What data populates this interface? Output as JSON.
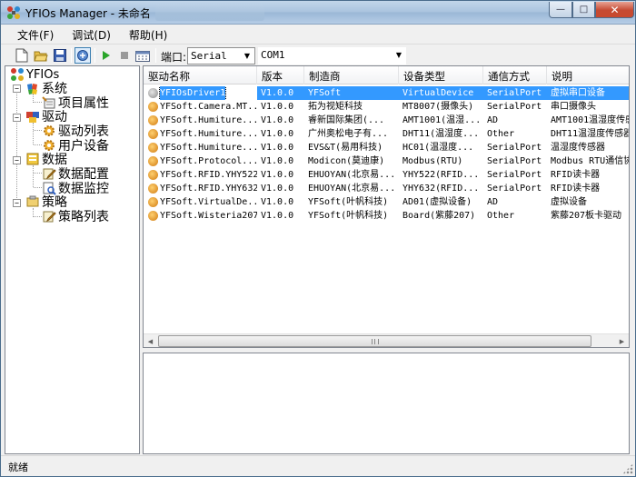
{
  "window": {
    "title": "YFIOs Manager - 未命名",
    "buttons": {
      "minimize": "—",
      "maximize": "□",
      "close": "✕"
    }
  },
  "menu": [
    {
      "label": "文件(F)"
    },
    {
      "label": "调试(D)"
    },
    {
      "label": "帮助(H)"
    }
  ],
  "toolbar": {
    "icons": [
      "new-file-icon",
      "open-folder-icon",
      "save-icon",
      "connect-icon",
      "run-icon",
      "stop-icon",
      "calendar-icon"
    ],
    "port_label": "端口:",
    "port_type": "Serial",
    "port_name": "COM1"
  },
  "tree": {
    "root": "YFIOs",
    "groups": [
      {
        "label": "系统",
        "children": [
          "项目属性"
        ]
      },
      {
        "label": "驱动",
        "children": [
          "驱动列表",
          "用户设备"
        ]
      },
      {
        "label": "数据",
        "children": [
          "数据配置",
          "数据监控"
        ]
      },
      {
        "label": "策略",
        "children": [
          "策略列表"
        ]
      }
    ]
  },
  "table": {
    "columns": [
      "驱动名称",
      "版本",
      "制造商",
      "设备类型",
      "通信方式",
      "说明"
    ],
    "rows": [
      [
        "YFIOsDriver1",
        "V1.0.0",
        "YFSoft",
        "VirtualDevice",
        "SerialPort",
        "虚拟串口设备"
      ],
      [
        "YFSoft.Camera.MT...",
        "V1.0.0",
        "拓为视矩科技",
        "MT8007(摄像头)",
        "SerialPort",
        "串口摄像头"
      ],
      [
        "YFSoft.Humiture....",
        "V1.0.0",
        "睿新国际集团(...",
        "AMT1001(温湿...",
        "AD",
        "AMT1001温湿度传感"
      ],
      [
        "YFSoft.Humiture....",
        "V1.0.0",
        "广州奥松电子有...",
        "DHT11(温湿度...",
        "Other",
        "DHT11温湿度传感器"
      ],
      [
        "YFSoft.Humiture....",
        "V1.0.0",
        "EVS&T(易用科技)",
        "HC01(温湿度...",
        "SerialPort",
        "温湿度传感器"
      ],
      [
        "YFSoft.Protocol....",
        "V1.0.0",
        "Modicon(莫迪康)",
        "Modbus(RTU)",
        "SerialPort",
        "Modbus RTU通信协"
      ],
      [
        "YFSoft.RFID.YHY522",
        "V1.0.0",
        "EHUOYAN(北京易...",
        "YHY522(RFID...",
        "SerialPort",
        "RFID读卡器"
      ],
      [
        "YFSoft.RFID.YHY632",
        "V1.0.0",
        "EHUOYAN(北京易...",
        "YHY632(RFID...",
        "SerialPort",
        "RFID读卡器"
      ],
      [
        "YFSoft.VirtualDe...",
        "V1.0.0",
        "YFSoft(叶帆科技)",
        "AD01(虚拟设备)",
        "AD",
        "虚拟设备"
      ],
      [
        "YFSoft.Wisteria207",
        "V1.0.0",
        "YFSoft(叶帆科技)",
        "Board(紫藤207)",
        "Other",
        "紫藤207板卡驱动"
      ]
    ],
    "selected_row": 0,
    "scroll_arrows": {
      "left": "◀",
      "right": "▶"
    }
  },
  "status": {
    "text": "就绪"
  },
  "colors": {
    "selection": "#3399ff",
    "titlebar": "#b6cde6",
    "close_button": "#c54a32"
  }
}
